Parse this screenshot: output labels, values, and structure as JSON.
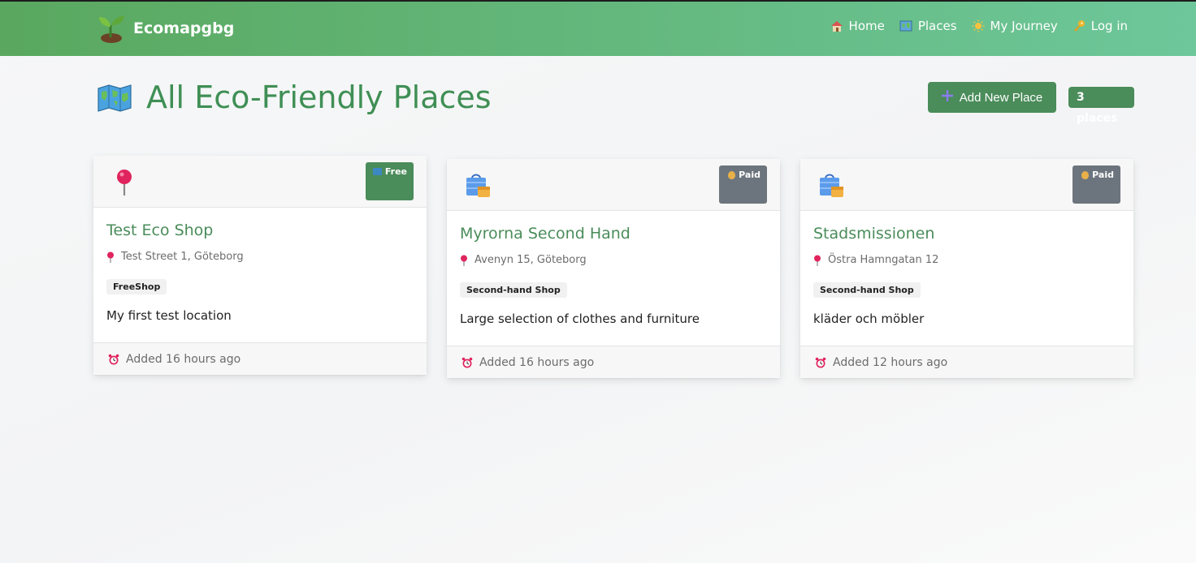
{
  "navbar": {
    "brand": "Ecomapgbg",
    "links": [
      {
        "label": "Home",
        "icon": "house-icon"
      },
      {
        "label": "Places",
        "icon": "map-icon"
      },
      {
        "label": "My Journey",
        "icon": "sun-icon"
      },
      {
        "label": "Log in",
        "icon": "key-icon"
      }
    ]
  },
  "header": {
    "title": "All Eco-Friendly Places",
    "add_button": "Add New Place",
    "count_badge": "3 places"
  },
  "places": [
    {
      "title": "Test Eco Shop",
      "icon": "round-pushpin-icon",
      "price": "Free",
      "price_color": "#4a8c5a",
      "address": "Test Street 1, Göteborg",
      "category": "FreeShop",
      "description": "My first test location",
      "added": "Added 16 hours ago"
    },
    {
      "title": "Myrorna Second Hand",
      "icon": "shopping-bag-icon",
      "price": "Paid",
      "price_color": "#6c757d",
      "address": "Avenyn 15, Göteborg",
      "category": "Second-hand Shop",
      "description": "Large selection of clothes and furniture",
      "added": "Added 16 hours ago"
    },
    {
      "title": "Stadsmissionen",
      "icon": "shopping-bag-icon",
      "price": "Paid",
      "price_color": "#6c757d",
      "address": "Östra Hamngatan 12",
      "category": "Second-hand Shop",
      "description": "kläder och möbler",
      "added": "Added 12 hours ago"
    }
  ],
  "colors": {
    "accent": "#4a8c5a",
    "nav_start": "#5aa85f",
    "nav_end": "#6dc79a",
    "paid": "#6c757d"
  }
}
